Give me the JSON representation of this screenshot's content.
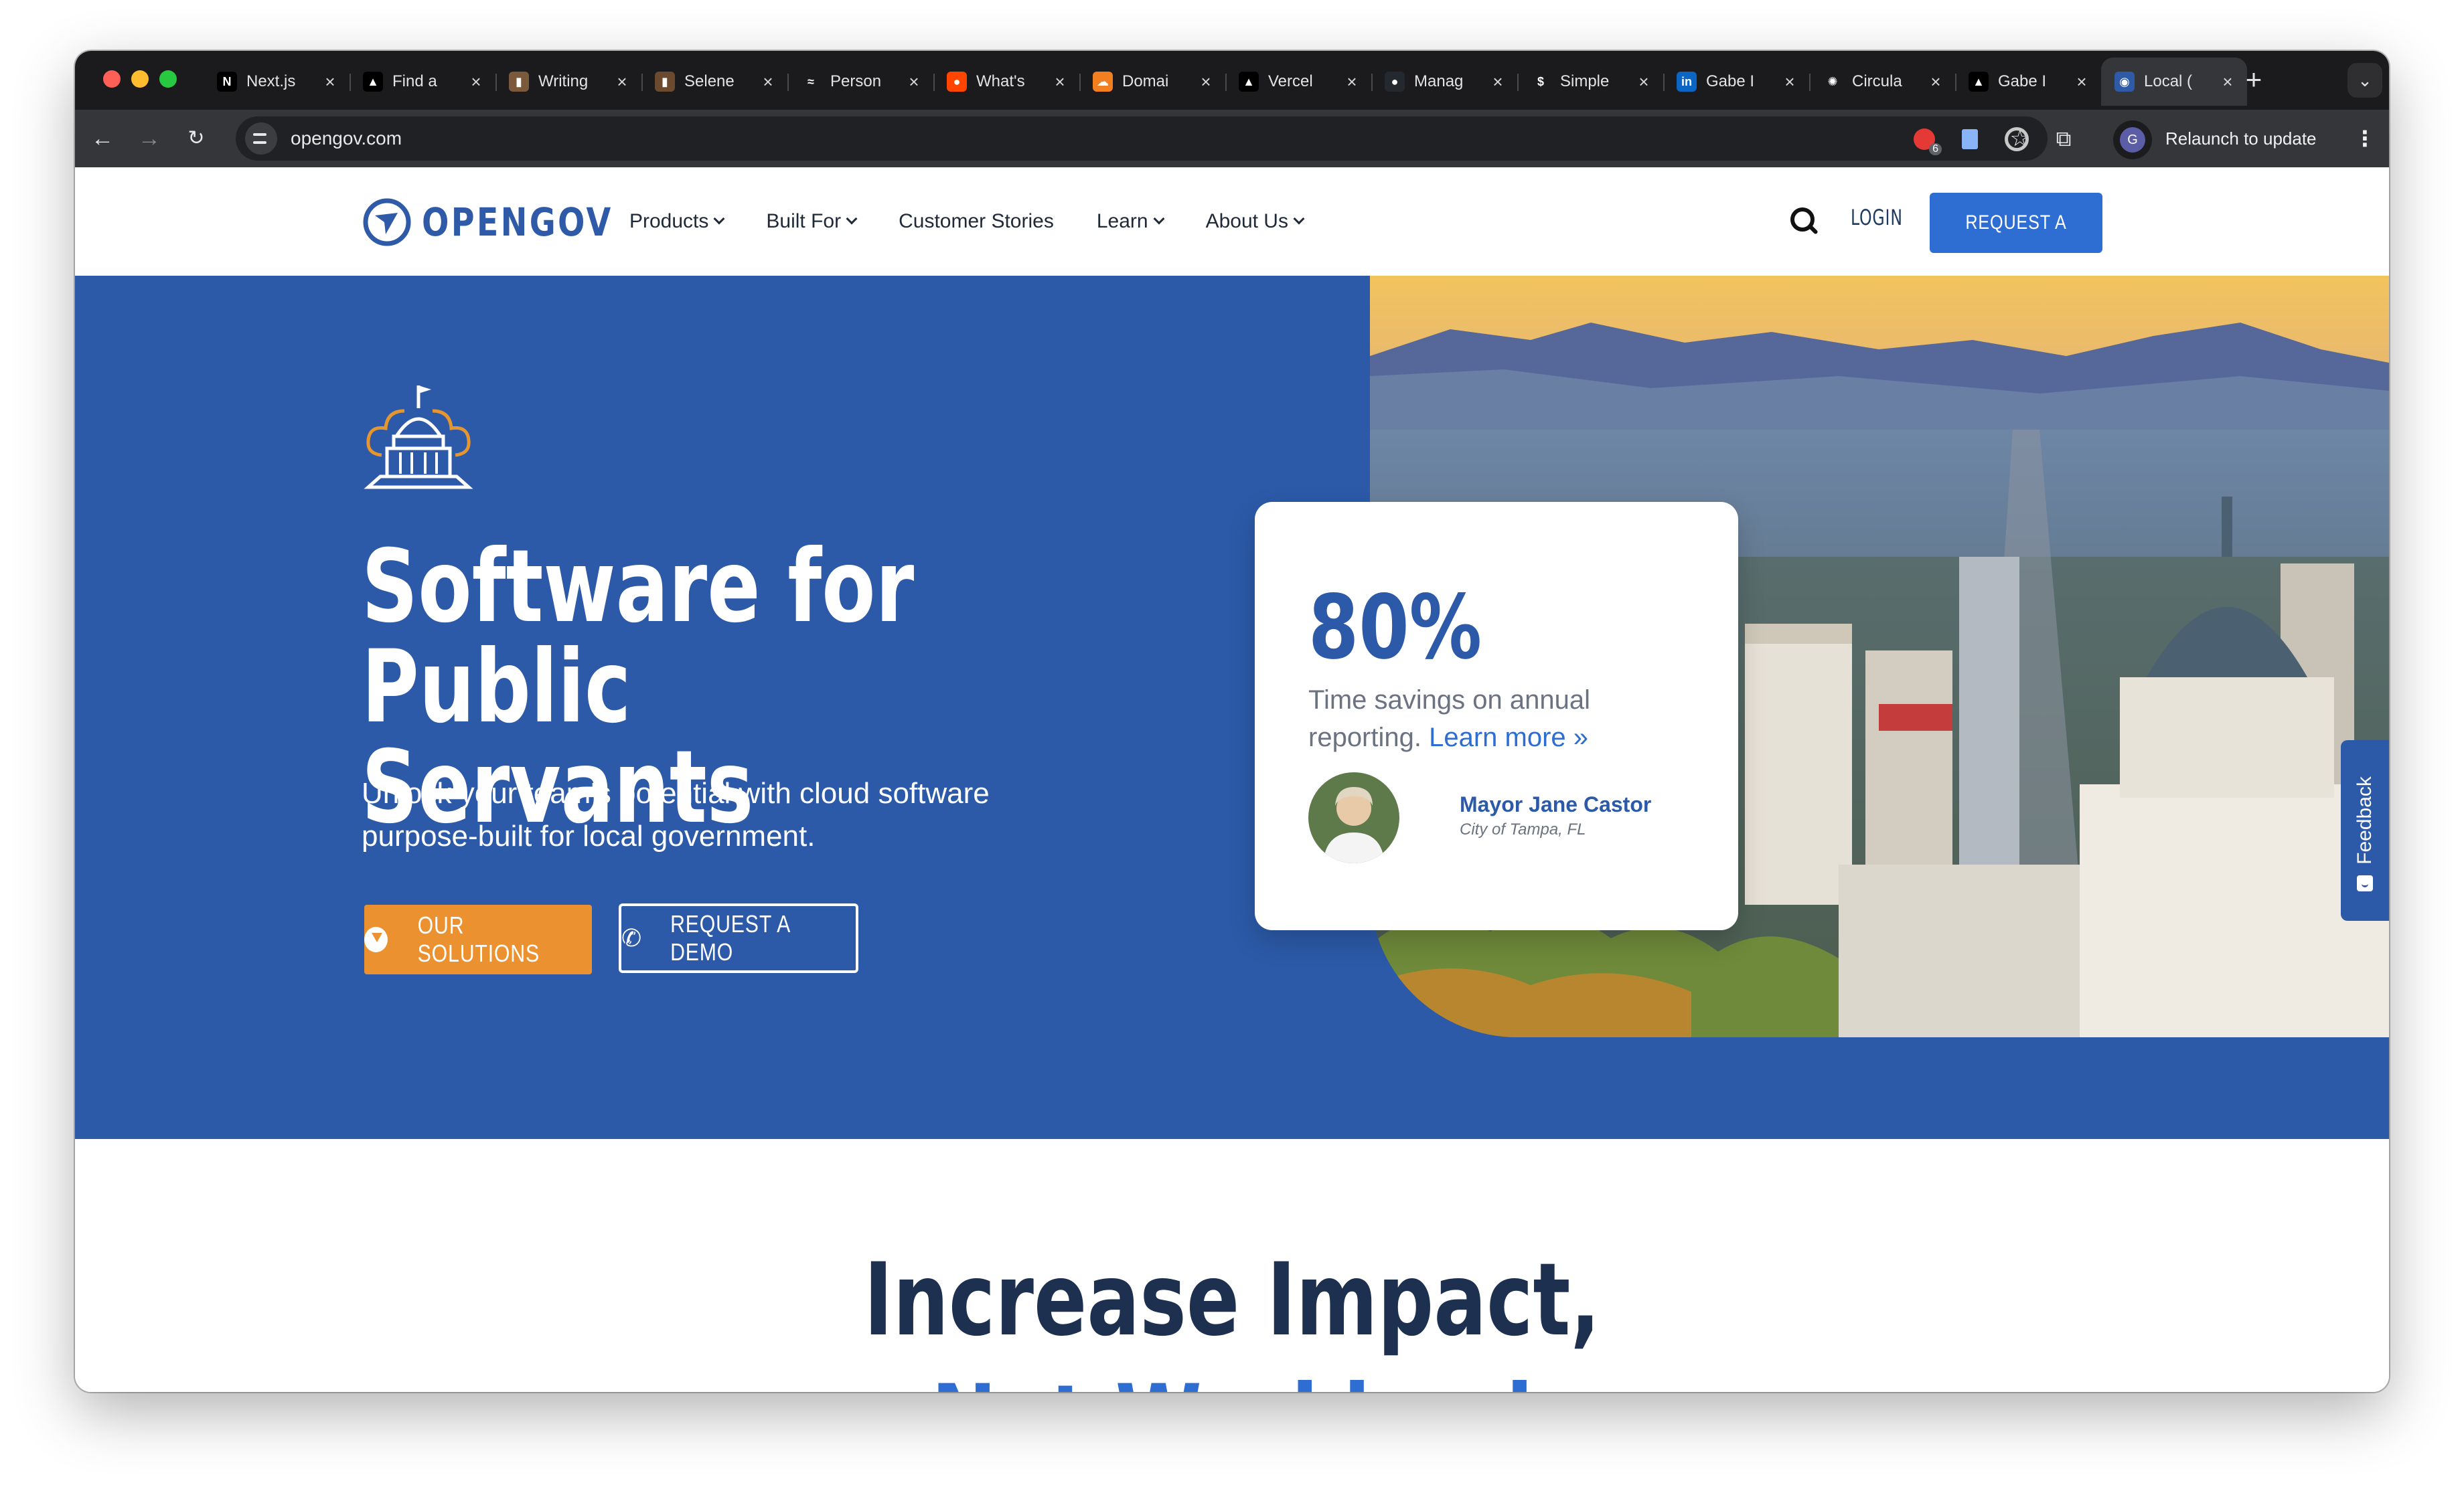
{
  "browser": {
    "tabs": [
      {
        "title": "Next.js",
        "icon": "nextjs-icon",
        "glyph": "N",
        "color": "#000000"
      },
      {
        "title": "Find a",
        "icon": "vercel-triangle-icon",
        "glyph": "▲",
        "color": "#000000"
      },
      {
        "title": "Writing",
        "icon": "portrait-icon",
        "glyph": "▮",
        "color": "#7a5a3a"
      },
      {
        "title": "Selene",
        "icon": "portrait-icon",
        "glyph": "▮",
        "color": "#6b4a30"
      },
      {
        "title": "Person",
        "icon": "wave-icon",
        "glyph": "≈",
        "color": "#1b1b1d"
      },
      {
        "title": "What's",
        "icon": "reddit-icon",
        "glyph": "●",
        "color": "#ff4500"
      },
      {
        "title": "Domai",
        "icon": "cloudflare-icon",
        "glyph": "☁",
        "color": "#f38020"
      },
      {
        "title": "Vercel",
        "icon": "vercel-triangle-icon",
        "glyph": "▲",
        "color": "#000000"
      },
      {
        "title": "Manag",
        "icon": "github-icon",
        "glyph": "●",
        "color": "#24292f"
      },
      {
        "title": "Simple",
        "icon": "dollar-icon",
        "glyph": "$",
        "color": "#1b1b1d"
      },
      {
        "title": "Gabe I",
        "icon": "linkedin-icon",
        "glyph": "in",
        "color": "#0a66c2"
      },
      {
        "title": "Circula",
        "icon": "openai-icon",
        "glyph": "✺",
        "color": "#1b1b1d"
      },
      {
        "title": "Gabe I",
        "icon": "vercel-triangle-icon",
        "glyph": "▲",
        "color": "#000000"
      },
      {
        "title": "Local (",
        "icon": "opengov-icon",
        "glyph": "◉",
        "color": "#2e5aa7",
        "active": true
      }
    ],
    "url": "opengov.com",
    "extension_badge": "6",
    "profile_initial": "G",
    "relaunch_label": "Relaunch to update"
  },
  "site": {
    "logo_text": "OPENGOV",
    "nav": [
      "Products",
      "Built For",
      "Customer Stories",
      "Learn",
      "About Us"
    ],
    "nav_has_caret": [
      true,
      true,
      false,
      true,
      true
    ],
    "login_label": "LOGIN",
    "request_demo_label": "REQUEST A DEMO"
  },
  "hero": {
    "title": "Software for Public Servants",
    "subtitle": "Unlock your team's potential with cloud software purpose-built for local government.",
    "solutions_label": "OUR SOLUTIONS",
    "demo_label": "REQUEST A DEMO",
    "stat": {
      "value": "80%",
      "text": "Time savings on annual reporting.",
      "link": "Learn more »",
      "person_name": "Mayor Jane Castor",
      "person_org": "City of Tampa, FL"
    }
  },
  "feedback_label": "Feedback",
  "section": {
    "title": "Increase Impact,",
    "subtitle": "Not Workload"
  },
  "colors": {
    "brand_blue": "#2c5aa8",
    "accent_orange": "#eb912f",
    "cta_blue": "#2e6dd1",
    "heading_navy": "#1d3050"
  }
}
